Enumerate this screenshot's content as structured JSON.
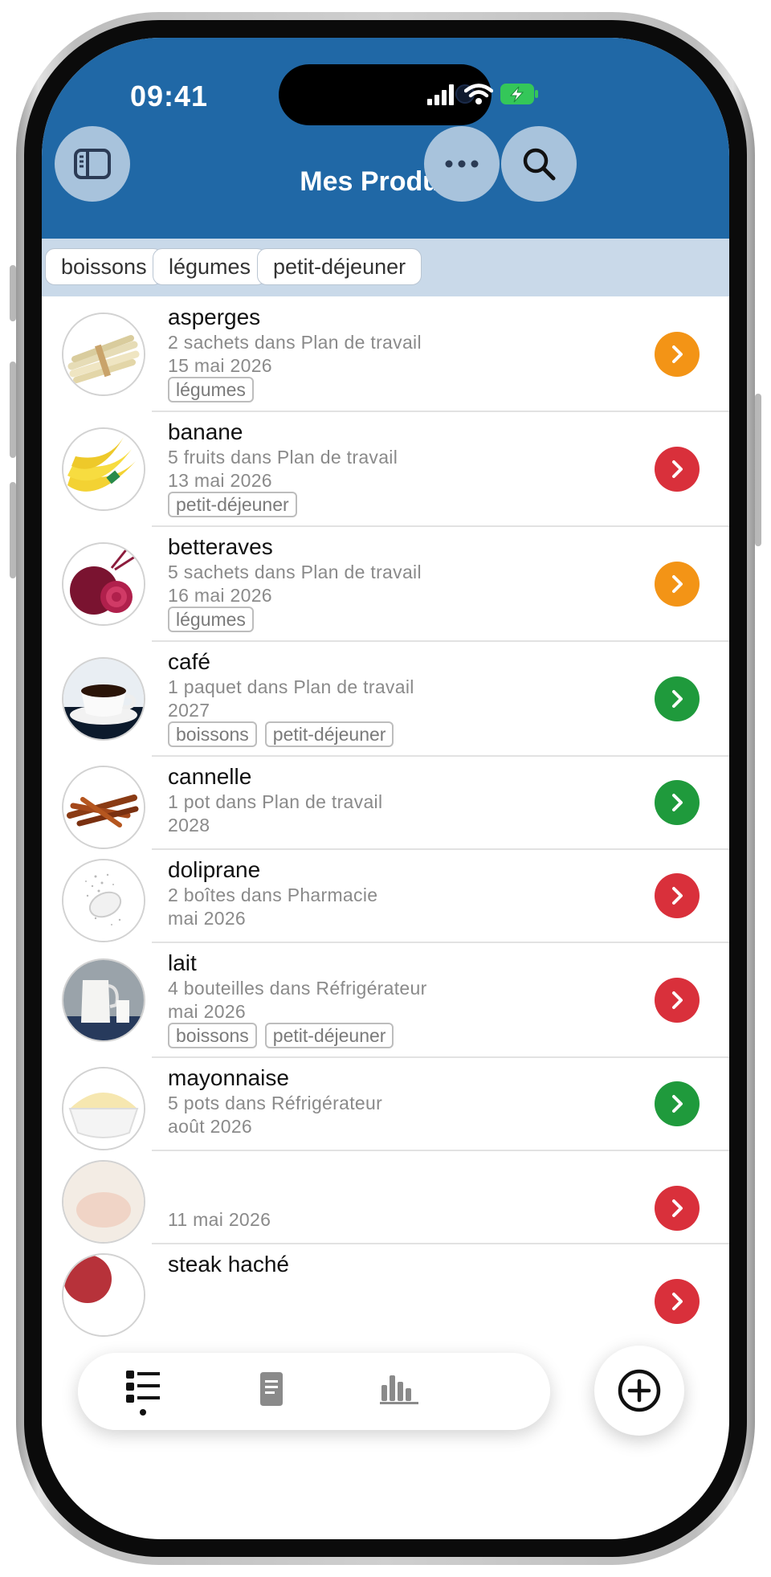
{
  "status": {
    "time": "09:41"
  },
  "header": {
    "title": "Mes Produits"
  },
  "filters": [
    "boissons",
    "légumes",
    "petit-déjeuner"
  ],
  "colors": {
    "header": "#2068a6",
    "orange": "#f39416",
    "red": "#d9303b",
    "green": "#1f9a3c"
  },
  "products": [
    {
      "name": "asperges",
      "qty": "2 sachets dans Plan de travail",
      "date": "15 mai 2026",
      "tags": [
        "légumes"
      ],
      "status": "orange"
    },
    {
      "name": "banane",
      "qty": "5 fruits dans Plan de travail",
      "date": "13 mai 2026",
      "tags": [
        "petit-déjeuner"
      ],
      "status": "red"
    },
    {
      "name": "betteraves",
      "qty": "5 sachets dans Plan de travail",
      "date": "16 mai 2026",
      "tags": [
        "légumes"
      ],
      "status": "orange"
    },
    {
      "name": "café",
      "qty": "1 paquet dans Plan de travail",
      "date": "2027",
      "tags": [
        "boissons",
        "petit-déjeuner"
      ],
      "status": "green"
    },
    {
      "name": "cannelle",
      "qty": "1 pot dans Plan de travail",
      "date": "2028",
      "tags": [],
      "status": "green"
    },
    {
      "name": "doliprane",
      "qty": "2 boîtes dans Pharmacie",
      "date": "mai 2026",
      "tags": [],
      "status": "red"
    },
    {
      "name": "lait",
      "qty": "4 bouteilles dans Réfrigérateur",
      "date": "mai 2026",
      "tags": [
        "boissons",
        "petit-déjeuner"
      ],
      "status": "red"
    },
    {
      "name": "mayonnaise",
      "qty": "5 pots dans Réfrigérateur",
      "date": "août 2026",
      "tags": [],
      "status": "green"
    },
    {
      "name": "",
      "qty": "",
      "date": "11 mai 2026",
      "tags": [],
      "status": "red"
    },
    {
      "name": "steak haché",
      "qty": "",
      "date": "",
      "tags": [],
      "status": "red"
    }
  ],
  "tabbar": {
    "icons": [
      "list-icon",
      "document-icon",
      "chart-icon"
    ],
    "add": "add-icon"
  }
}
